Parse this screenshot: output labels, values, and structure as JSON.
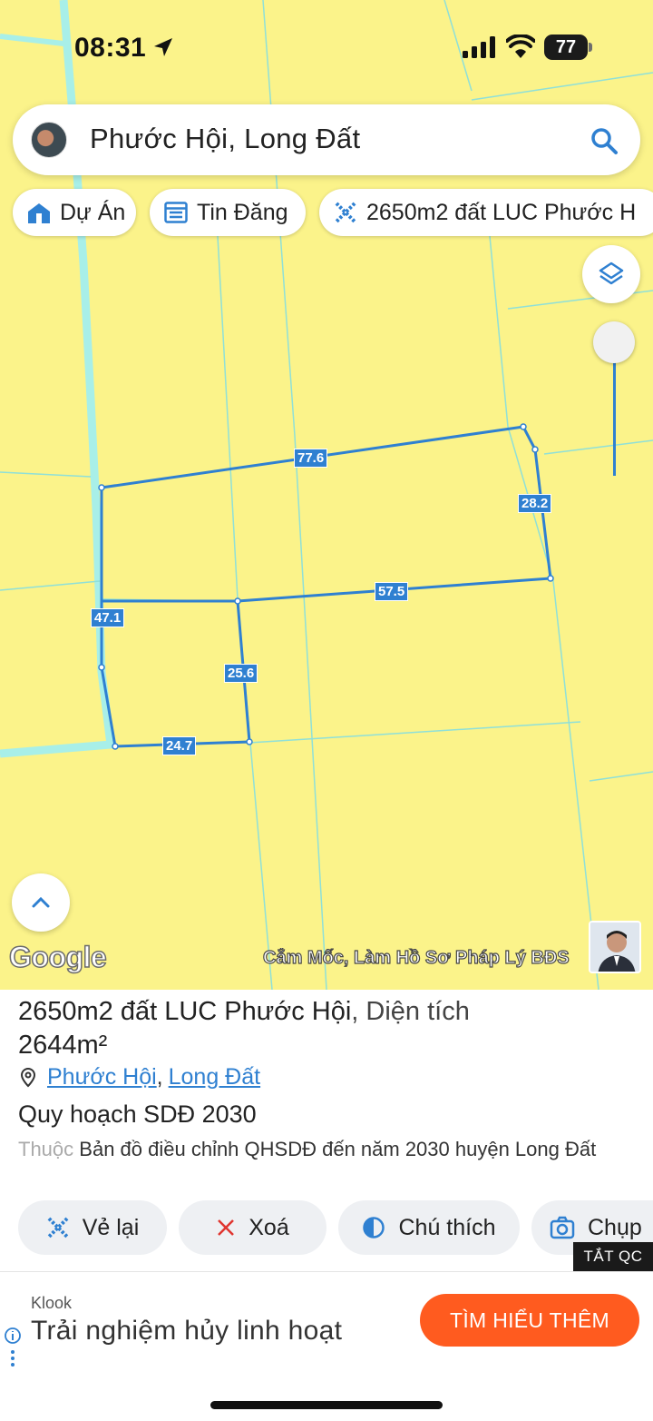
{
  "status": {
    "time": "08:31",
    "battery": "77"
  },
  "search": {
    "query": "Phước Hội, Long Đất"
  },
  "chips": [
    {
      "label": "Dự Án",
      "icon": "building-icon"
    },
    {
      "label": "Tin Đăng",
      "icon": "calendar-list-icon"
    },
    {
      "label": "2650m2 đất LUC Phước H",
      "icon": "ruler-icon"
    }
  ],
  "map": {
    "dimensions": [
      "77.6",
      "28.2",
      "57.5",
      "47.1",
      "25.6",
      "24.7"
    ],
    "attribution": "Google",
    "caption": "Cắm Mốc, Làm Hồ Sơ Pháp Lý BĐS",
    "colors": {
      "land": "#fbf38a",
      "water": "#a8efe8",
      "parcel_line": "#2f80d1"
    }
  },
  "parcel": {
    "title": "2650m2 đất LUC Phước Hội",
    "area_prefix": ", Diện tích",
    "area_value": "2644m²",
    "location_1": "Phước Hội",
    "location_separator": ",",
    "location_2": "Long Đất",
    "plan_title": "Quy hoạch SDĐ 2030",
    "plan_prefix": "Thuộc",
    "plan_desc": "Bản đồ điều chỉnh QHSDĐ đến năm 2030 huyện Long Đất"
  },
  "actions": [
    {
      "label": "Vẻ lại",
      "icon": "redraw-icon"
    },
    {
      "label": "Xoá",
      "icon": "close-icon"
    },
    {
      "label": "Chú thích",
      "icon": "contrast-icon"
    },
    {
      "label": "Chụp",
      "icon": "camera-icon"
    }
  ],
  "ad": {
    "tag": "TẮT QC",
    "brand": "Klook",
    "text": "Trải nghiệm hủy linh hoạt",
    "cta": "TÌM HIỂU THÊM",
    "accent": "#ff5b1f"
  }
}
